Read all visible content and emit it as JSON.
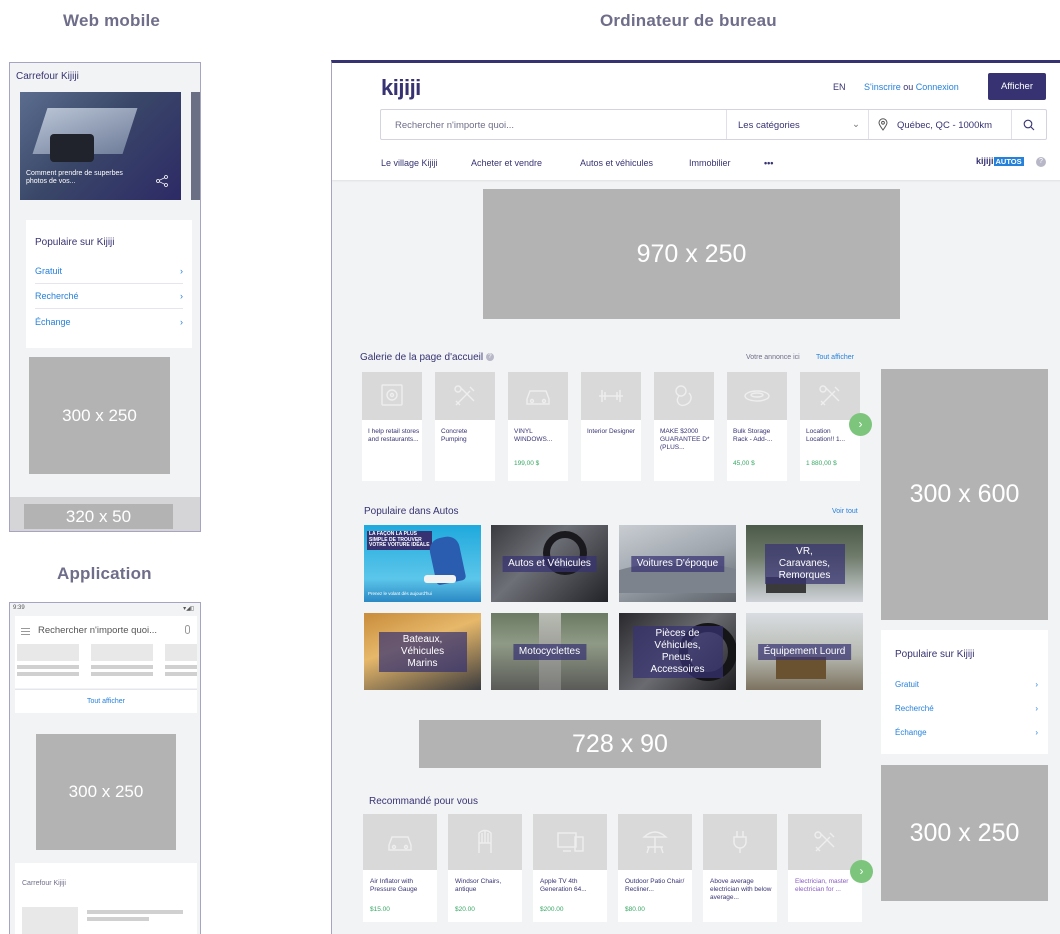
{
  "headers": {
    "web_mobile": "Web mobile",
    "desktop": "Ordinateur de bureau",
    "application": "Application"
  },
  "mobile": {
    "header": "Carrefour Kijiji",
    "carousel_caption": "Comment prendre de superbes photos de vos...",
    "popular_title": "Populaire sur Kijiji",
    "popular_items": [
      "Gratuit",
      "Recherché",
      "Échange"
    ],
    "ad_300": "300 x 250",
    "ad_320": "320 x 50"
  },
  "app": {
    "status_time": "9:39",
    "search_placeholder": "Rechercher n'importe quoi...",
    "see_all": "Tout afficher",
    "ad_300": "300 x 250",
    "section_title": "Carrefour Kijiji"
  },
  "desktop": {
    "logo": "kijiji",
    "lang": "EN",
    "signup": "S'inscrire",
    "or": "ou",
    "login": "Connexion",
    "post_button": "Afficher",
    "search_placeholder": "Rechercher n'importe quoi...",
    "category_select": "Les catégories",
    "location": "Québec, QC - 1000km",
    "nav": [
      "Le village Kijiji",
      "Acheter et vendre",
      "Autos et véhicules",
      "Immobilier"
    ],
    "nav_more": "•••",
    "autos_logo_a": "kijiji",
    "autos_logo_b": "AUTOS",
    "ad_970": "970 x 250",
    "gallery_title": "Galerie de la page d'accueil",
    "gallery_promo": "Votre annonce ici",
    "gallery_see_all": "Tout afficher",
    "gallery": [
      {
        "title": "I help retail stores and restaurants...",
        "price": "",
        "icon": "monitor-icon"
      },
      {
        "title": "Concrete Pumping",
        "price": "",
        "icon": "tools-icon"
      },
      {
        "title": "VINYL WINDOWS...",
        "price": "199,00 $",
        "icon": "car-icon"
      },
      {
        "title": "Interior Designer",
        "price": "",
        "icon": "dumbbell-icon"
      },
      {
        "title": "MAKE $2000 GUARANTEE D* (PLUS...",
        "price": "",
        "icon": "puppy-icon"
      },
      {
        "title": "Bulk Storage Rack - Add-...",
        "price": "45,00 $",
        "icon": "ring-icon"
      },
      {
        "title": "Location Location!! 1...",
        "price": "1 880,00 $",
        "icon": "tools-icon"
      }
    ],
    "autos_title": "Populaire dans Autos",
    "autos_see_all": "Voir tout",
    "promo_text_a": "LA FAÇON LA PLUS",
    "promo_text_b": "SIMPLE DE TROUVER",
    "promo_text_c": "VOTRE VOITURE IDÉALE",
    "promo_cta": "Prenez le volant dès aujourd'hui",
    "autos_tiles": [
      "Autos et Véhicules",
      "Voitures D'époque",
      "VR, Caravanes, Remorques",
      "Bateaux, Véhicules Marins",
      "Motocyclettes",
      "Pièces de Véhicules, Pneus, Accessoires",
      "Équipement Lourd"
    ],
    "ad_728": "728 x 90",
    "rec_title": "Recommandé pour vous",
    "recommended": [
      {
        "title": "Air Inflator with Pressure Gauge",
        "price": "$15.00",
        "icon": "car-icon"
      },
      {
        "title": "Windsor Chairs, antique",
        "price": "$20.00",
        "icon": "chair-icon"
      },
      {
        "title": "Apple TV 4th Generation 64...",
        "price": "$200.00",
        "icon": "devices-icon"
      },
      {
        "title": "Outdoor Patio Chair/ Recliner...",
        "price": "$80.00",
        "icon": "patio-icon"
      },
      {
        "title": "Above average electrician with below average...",
        "price": "",
        "icon": "plug-icon"
      },
      {
        "title": "Electrician, master electrician for ...",
        "price": "",
        "icon": "tools-icon"
      }
    ],
    "ad_300_600": "300 x 600",
    "popular_title": "Populaire sur Kijiji",
    "popular_items": [
      "Gratuit",
      "Recherché",
      "Échange"
    ],
    "ad_300_250": "300 x 250"
  },
  "colors": {
    "brand": "#373373",
    "link": "#2681db",
    "price": "#37a864",
    "ad_gray": "#b3b3b3"
  }
}
